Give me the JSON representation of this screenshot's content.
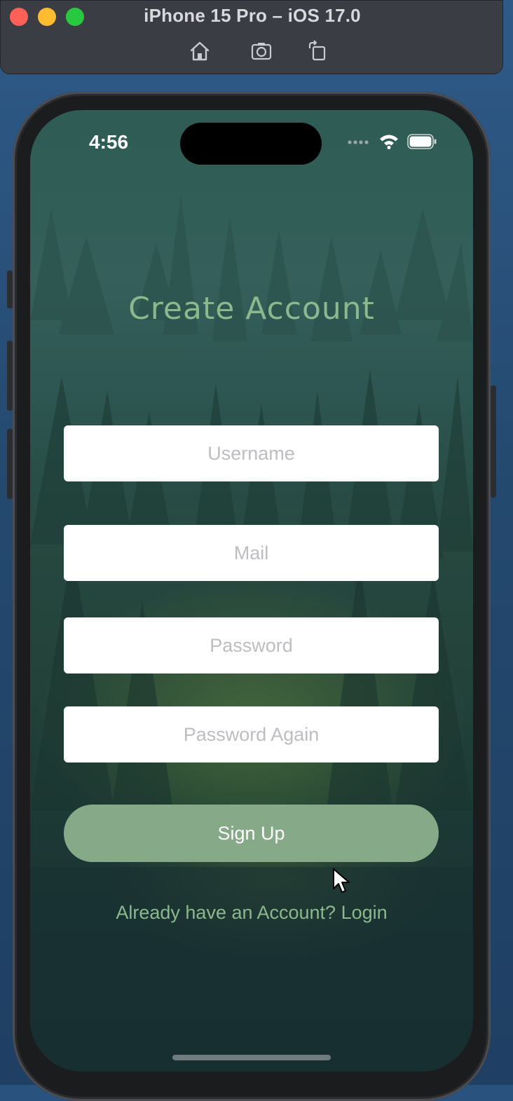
{
  "window": {
    "title": "iPhone 15 Pro – iOS 17.0",
    "toolbar_icons": [
      "home-icon",
      "screenshot-icon",
      "rotate-icon"
    ]
  },
  "status_bar": {
    "time": "4:56",
    "icons": [
      "cellular-icon",
      "wifi-icon",
      "battery-icon"
    ]
  },
  "screen": {
    "title": "Create Account",
    "fields": {
      "username_placeholder": "Username",
      "mail_placeholder": "Mail",
      "password_placeholder": "Password",
      "password_again_placeholder": "Password Again"
    },
    "signup_label": "Sign Up",
    "login_link": "Already have an Account? Login"
  },
  "colors": {
    "accent": "#86a988",
    "title_text": "#8cb88e",
    "background": "#23423a"
  }
}
